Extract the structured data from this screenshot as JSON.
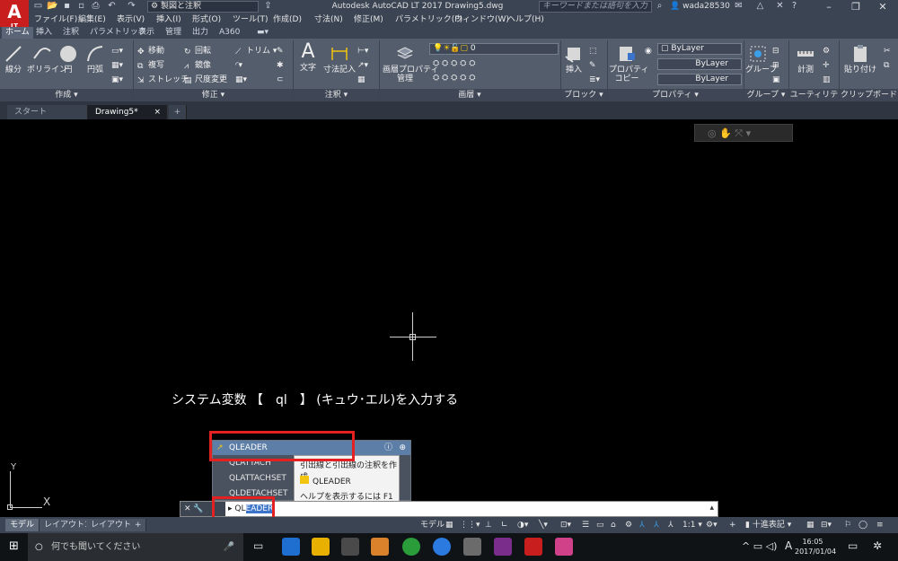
{
  "app": {
    "title": "Autodesk AutoCAD LT 2017    Drawing5.dwg",
    "logo_letter": "A",
    "logo_sub": "LT",
    "workspace": "製図と注釈",
    "search_placeholder": "キーワードまたは語句を入力",
    "user": "wada28530",
    "accent": "#c81e1e"
  },
  "menu": [
    "ファイル(F)",
    "編集(E)",
    "表示(V)",
    "挿入(I)",
    "形式(O)",
    "ツール(T)",
    "作成(D)",
    "寸法(N)",
    "修正(M)",
    "パラメトリック(P)",
    "ウィンドウ(W)",
    "ヘルプ(H)"
  ],
  "ribbon_tabs": [
    "ホーム",
    "挿入",
    "注釈",
    "パラメトリック",
    "表示",
    "管理",
    "出力",
    "A360"
  ],
  "ribbon": {
    "draw": {
      "line": "線分",
      "polyline": "ポリライン",
      "circle": "円",
      "arc": "円弧",
      "panel": "作成 ▾"
    },
    "modify": {
      "move": "移動",
      "rotate": "回転",
      "trim": "トリム",
      "copy": "複写",
      "mirror": "鏡像",
      "stretch": "ストレッチ",
      "scale": "尺度変更",
      "panel": "修正 ▾"
    },
    "annotation": {
      "text": "文字",
      "dimension": "寸法記入",
      "panel": "注釈 ▾"
    },
    "layers": {
      "properties_line1": "画層プロパティ",
      "properties_line2": "管理",
      "current": "0",
      "panel": "画層 ▾"
    },
    "block": {
      "insert": "挿入",
      "panel": "ブロック ▾"
    },
    "properties": {
      "match_line1": "プロパティ",
      "match_line2": "コピー",
      "color": "ByLayer",
      "linetype": "ByLayer",
      "lineweight": "ByLayer",
      "panel": "プロパティ ▾"
    },
    "groups": {
      "group": "グループ",
      "panel": "グループ ▾"
    },
    "utilities": {
      "measure": "計測",
      "panel": "ユーティリティ ▾"
    },
    "clipboard": {
      "paste": "貼り付け",
      "panel": "クリップボード"
    }
  },
  "doc_tabs": {
    "start": "スタート",
    "drawing": "Drawing5*",
    "close": "×",
    "add": "+"
  },
  "caption": "システム変数 【　ql　】 (キュウ･エル)を入力する",
  "ucs": {
    "x": "X",
    "y": "Y"
  },
  "autocomplete": {
    "selected": "QLEADER",
    "items": [
      "QLATTACH",
      "QLATTACHSET",
      "QLDETACHSET"
    ],
    "tooltip_title": "引出線と引出線の注釈を作成",
    "tooltip_cmd": "QLEADER",
    "tooltip_help": "ヘルプを表示するには F1 キー"
  },
  "command": {
    "typed": "QL",
    "completion": "EADER",
    "prefix": "▸"
  },
  "layout_tabs": [
    "モデル",
    "レイアウト1",
    "レイアウト2"
  ],
  "status": {
    "model": "モデル",
    "scale": "1:1",
    "units": "十進表記"
  },
  "taskbar": {
    "search": "何でも聞いてください",
    "time": "16:05",
    "date": "2017/01/04",
    "ime": "A"
  }
}
